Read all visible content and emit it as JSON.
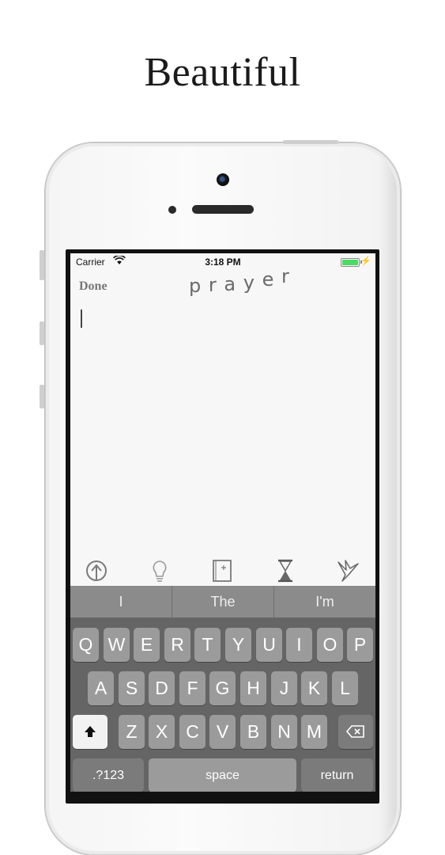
{
  "headline": "Beautiful",
  "statusbar": {
    "carrier": "Carrier",
    "time": "3:18 PM"
  },
  "nav": {
    "done_label": "Done",
    "logo_letters": [
      "p",
      "r",
      "a",
      "y",
      "e",
      "r"
    ]
  },
  "toolbar": {
    "icons": [
      "upload-circle-icon",
      "lightbulb-icon",
      "book-icon",
      "hourglass-icon",
      "origami-crane-icon"
    ]
  },
  "keyboard": {
    "suggestions": [
      "I",
      "The",
      "I'm"
    ],
    "row1": [
      "Q",
      "W",
      "E",
      "R",
      "T",
      "Y",
      "U",
      "I",
      "O",
      "P"
    ],
    "row2": [
      "A",
      "S",
      "D",
      "F",
      "G",
      "H",
      "J",
      "K",
      "L"
    ],
    "row3": [
      "Z",
      "X",
      "C",
      "V",
      "B",
      "N",
      "M"
    ],
    "numbers_label": ".?123",
    "space_label": "space",
    "return_label": "return"
  },
  "colors": {
    "keyboard_bg": "#656565",
    "key_bg": "#9b9b9b",
    "battery": "#4cd964"
  }
}
